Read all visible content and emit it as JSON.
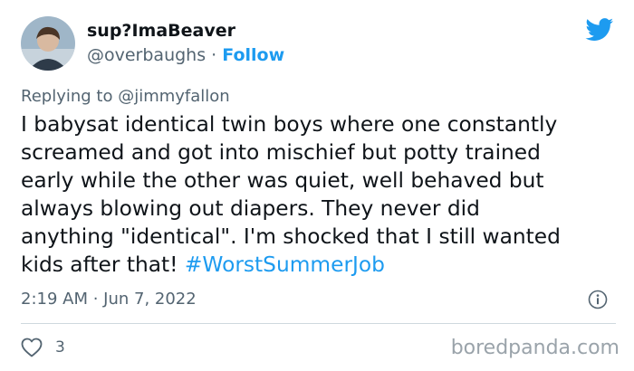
{
  "tweet": {
    "display_name": "sup?ImaBeaver",
    "handle": "@overbaughs",
    "separator": " · ",
    "follow_label": "Follow",
    "replying_to_label": "Replying to ",
    "replying_to_handle": "@jimmyfallon",
    "text_lines": [
      "I babysat identical twin boys where one constantly",
      "screamed and got into mischief but potty trained",
      "early while the other was quiet, well behaved but",
      "always blowing out diapers. They never did",
      "anything \"identical\". I'm shocked that I still wanted",
      "kids after that! "
    ],
    "hashtag": "#WorstSummerJob",
    "timestamp": "2:19 AM · Jun 7, 2022",
    "like_count": "3",
    "accent_color": "#1d9bf0"
  },
  "icons": {
    "brand": "twitter-bird-icon",
    "info": "info-icon",
    "like": "heart-icon"
  },
  "watermark": "boredpanda.com"
}
